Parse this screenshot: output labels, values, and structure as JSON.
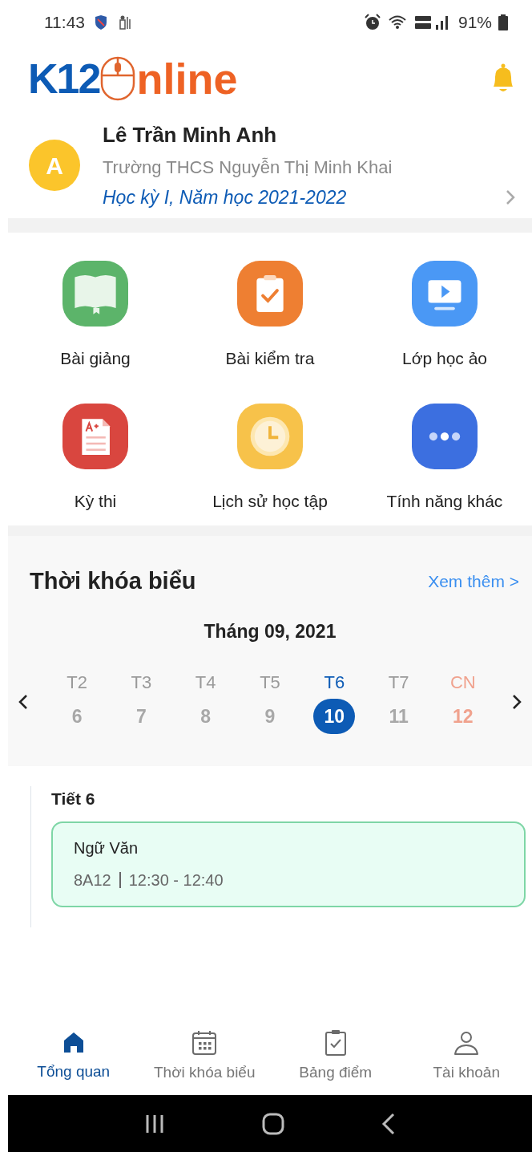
{
  "status_bar": {
    "time": "11:43",
    "battery": "91%"
  },
  "logo": {
    "left": "K12",
    "right": "nline"
  },
  "profile": {
    "avatar": "A",
    "name": "Lê Trần Minh Anh",
    "school": "Trường THCS Nguyễn Thị Minh Khai",
    "term": "Học kỳ I, Năm học 2021-2022"
  },
  "features": [
    {
      "kind": "book",
      "label": "Bài giảng"
    },
    {
      "kind": "clipboard",
      "label": "Bài kiểm tra"
    },
    {
      "kind": "video",
      "label": "Lớp học ảo"
    },
    {
      "kind": "exam",
      "label": "Kỳ thi"
    },
    {
      "kind": "clock",
      "label": "Lịch sử học tập"
    },
    {
      "kind": "more",
      "label": "Tính năng khác"
    }
  ],
  "schedule": {
    "title": "Thời khóa biểu",
    "more_link": "Xem thêm >",
    "month": "Tháng 09, 2021",
    "days": [
      {
        "weekday": "T2",
        "date": "6",
        "kind": "weekday",
        "selected": false
      },
      {
        "weekday": "T3",
        "date": "7",
        "kind": "weekday",
        "selected": false
      },
      {
        "weekday": "T4",
        "date": "8",
        "kind": "weekday",
        "selected": false
      },
      {
        "weekday": "T5",
        "date": "9",
        "kind": "weekday",
        "selected": false
      },
      {
        "weekday": "T6",
        "date": "10",
        "kind": "weekday",
        "selected": true
      },
      {
        "weekday": "T7",
        "date": "11",
        "kind": "weekday",
        "selected": false
      },
      {
        "weekday": "CN",
        "date": "12",
        "kind": "sunday",
        "selected": false
      }
    ],
    "lessons": [
      {
        "period": "Tiết 6",
        "subject": "Ngữ Văn",
        "class": "8A12",
        "time": "12:30 - 12:40"
      }
    ]
  },
  "bottom_nav": [
    {
      "kind": "home",
      "label": "Tổng quan",
      "selected": true
    },
    {
      "kind": "calendar",
      "label": "Thời khóa biểu",
      "selected": false
    },
    {
      "kind": "clipboard",
      "label": "Bảng điểm",
      "selected": false
    },
    {
      "kind": "person",
      "label": "Tài khoản",
      "selected": false
    }
  ]
}
